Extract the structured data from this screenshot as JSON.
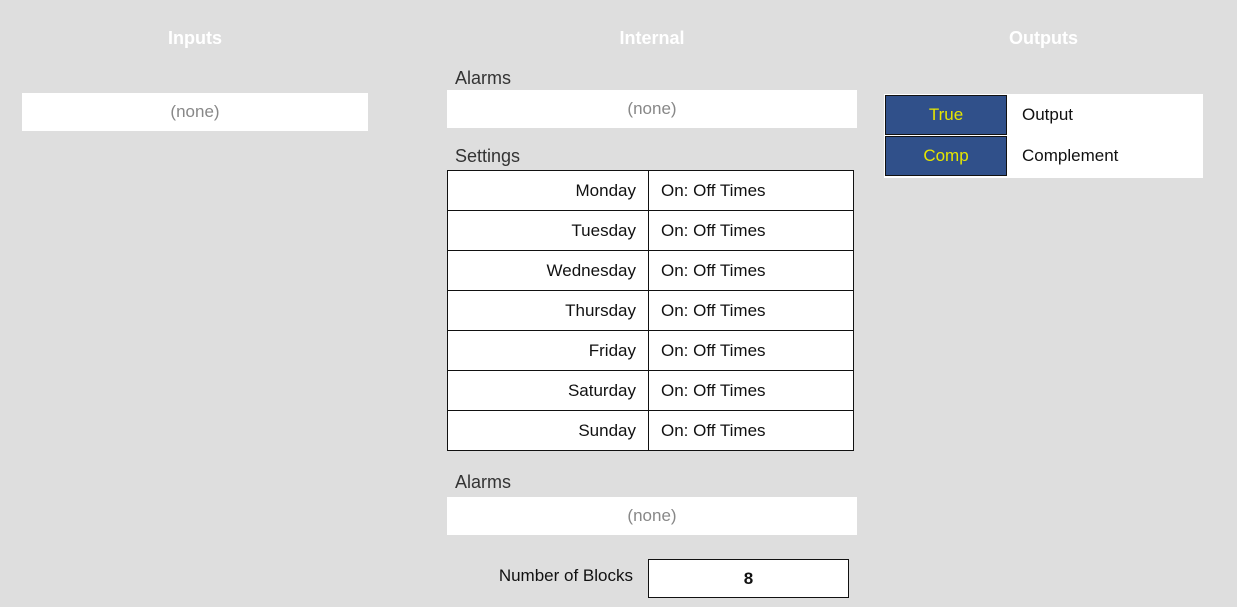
{
  "columns": {
    "inputs_title": "Inputs",
    "internal_title": "Internal",
    "outputs_title": "Outputs"
  },
  "inputs": {
    "value": "(none)"
  },
  "internal": {
    "alarms_top": {
      "label": "Alarms",
      "value": "(none)"
    },
    "settings": {
      "label": "Settings",
      "rows": [
        {
          "day": "Monday",
          "value": "On: Off Times"
        },
        {
          "day": "Tuesday",
          "value": "On: Off Times"
        },
        {
          "day": "Wednesday",
          "value": "On: Off Times"
        },
        {
          "day": "Thursday",
          "value": "On: Off Times"
        },
        {
          "day": "Friday",
          "value": "On: Off Times"
        },
        {
          "day": "Saturday",
          "value": "On: Off Times"
        },
        {
          "day": "Sunday",
          "value": "On: Off Times"
        }
      ]
    },
    "alarms_bottom": {
      "label": "Alarms",
      "value": "(none)"
    },
    "number_of_blocks": {
      "label": "Number of Blocks",
      "value": "8"
    }
  },
  "outputs": [
    {
      "tag": "True",
      "label": "Output"
    },
    {
      "tag": "Comp",
      "label": "Complement"
    }
  ],
  "colors": {
    "background": "#dedede",
    "tag_fill": "#30508a",
    "tag_text": "#e6e600"
  }
}
